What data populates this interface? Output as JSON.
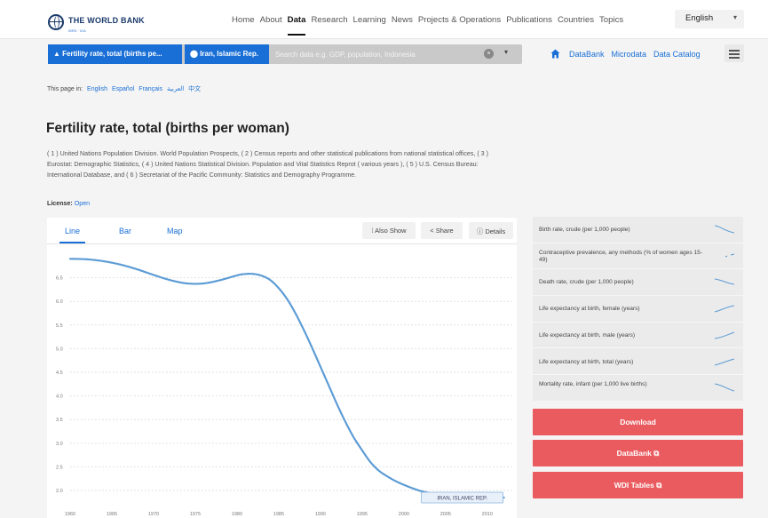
{
  "logo": {
    "text": "THE WORLD BANK",
    "subtext": "IBRD · IDA"
  },
  "nav": {
    "items": [
      "Home",
      "About",
      "Data",
      "Research",
      "Learning",
      "News",
      "Projects & Operations",
      "Publications",
      "Countries",
      "Topics"
    ],
    "active": "Data",
    "language": "English"
  },
  "search": {
    "indicator_chip": "Fertility rate, total (births pe...",
    "country_chip": "Iran, Islamic Rep.",
    "placeholder": "Search data e.g. GDP, population, Indonesia"
  },
  "sublinks": [
    "DataBank",
    "Microdata",
    "Data Catalog"
  ],
  "languages": {
    "prefix": "This page in:",
    "items": [
      "English",
      "Español",
      "Français",
      "العربية",
      "中文"
    ]
  },
  "title": "Fertility rate, total (births per woman)",
  "sources": "( 1 ) United Nations Population Division. World Population Prospects, ( 2 ) Census reports and other statistical publications from national statistical offices, ( 3 ) Eurostat: Demographic Statistics, ( 4 ) United Nations Statistical Division. Population and Vital Statistics Reprot ( various years ), ( 5 ) U.S. Census Bureau: International Database, and ( 6 ) Secretariat of the Pacific Community: Statistics and Demography Programme.",
  "license": {
    "label": "License:",
    "value": "Open"
  },
  "chart_tabs": [
    "Line",
    "Bar",
    "Map"
  ],
  "chart_buttons": {
    "also_show": "Also Show",
    "share": "Share",
    "details": "Details"
  },
  "chart_data": {
    "type": "line",
    "title": "Fertility rate, total (births per woman)",
    "xlabel": "",
    "ylabel": "",
    "x_ticks": [
      "1960",
      "1965",
      "1970",
      "1975",
      "1980",
      "1985",
      "1990",
      "1995",
      "2000",
      "2005",
      "2010"
    ],
    "y_ticks": [
      "2.0",
      "2.5",
      "3.0",
      "3.5",
      "4.0",
      "4.5",
      "5.0",
      "5.5",
      "6.0",
      "6.5"
    ],
    "xlim": [
      1960,
      2013
    ],
    "ylim": [
      1.7,
      7.0
    ],
    "grid": true,
    "series": [
      {
        "name": "IRAN, ISLAMIC REP.",
        "color": "#5b9bd5",
        "x": [
          1960,
          1962,
          1964,
          1966,
          1968,
          1970,
          1972,
          1974,
          1976,
          1978,
          1980,
          1981,
          1982,
          1983,
          1984,
          1985,
          1986,
          1987,
          1988,
          1989,
          1990,
          1991,
          1992,
          1993,
          1994,
          1995,
          1996,
          1997,
          1998,
          1999,
          2000,
          2001,
          2002,
          2003,
          2004,
          2005,
          2006,
          2008,
          2010,
          2012
        ],
        "y": [
          6.9,
          6.89,
          6.85,
          6.78,
          6.68,
          6.56,
          6.45,
          6.38,
          6.38,
          6.45,
          6.55,
          6.58,
          6.58,
          6.54,
          6.45,
          6.28,
          6.05,
          5.75,
          5.4,
          5.02,
          4.62,
          4.22,
          3.82,
          3.45,
          3.12,
          2.85,
          2.6,
          2.42,
          2.3,
          2.2,
          2.12,
          2.05,
          1.99,
          1.95,
          1.92,
          1.9,
          1.88,
          1.86,
          1.85,
          1.85
        ]
      }
    ]
  },
  "related": [
    "Birth rate, crude (per 1,000 people)",
    "Contraceptive prevalence, any methods (% of women ages 15-49)",
    "Death rate, crude (per 1,000 people)",
    "Life expectancy at birth, female (years)",
    "Life expectancy at birth, male (years)",
    "Life expectancy at birth, total (years)",
    "Mortality rate, infant (per 1,000 live births)"
  ],
  "actions": {
    "download": "Download",
    "databank": "DataBank ⧉",
    "wdi": "WDI Tables ⧉"
  }
}
